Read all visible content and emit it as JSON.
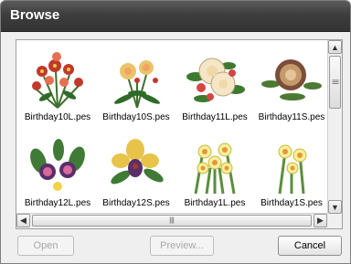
{
  "window": {
    "title": "Browse"
  },
  "files": [
    {
      "name": "Birthday10L.pes",
      "icon": "flower-bouquet-icon"
    },
    {
      "name": "Birthday10S.pes",
      "icon": "flower-bouquet-icon"
    },
    {
      "name": "Birthday11L.pes",
      "icon": "flower-bouquet-icon"
    },
    {
      "name": "Birthday11S.pes",
      "icon": "flower-bouquet-icon"
    },
    {
      "name": "Birthday12L.pes",
      "icon": "flower-bouquet-icon"
    },
    {
      "name": "Birthday12S.pes",
      "icon": "flower-bouquet-icon"
    },
    {
      "name": "Birthday1L.pes",
      "icon": "flower-bouquet-icon"
    },
    {
      "name": "Birthday1S.pes",
      "icon": "flower-bouquet-icon"
    }
  ],
  "buttons": {
    "open": "Open",
    "preview": "Preview...",
    "cancel": "Cancel"
  },
  "scroll_arrows": {
    "up": "▲",
    "down": "▼",
    "left": "◀",
    "right": "▶",
    "grip": "|||"
  }
}
